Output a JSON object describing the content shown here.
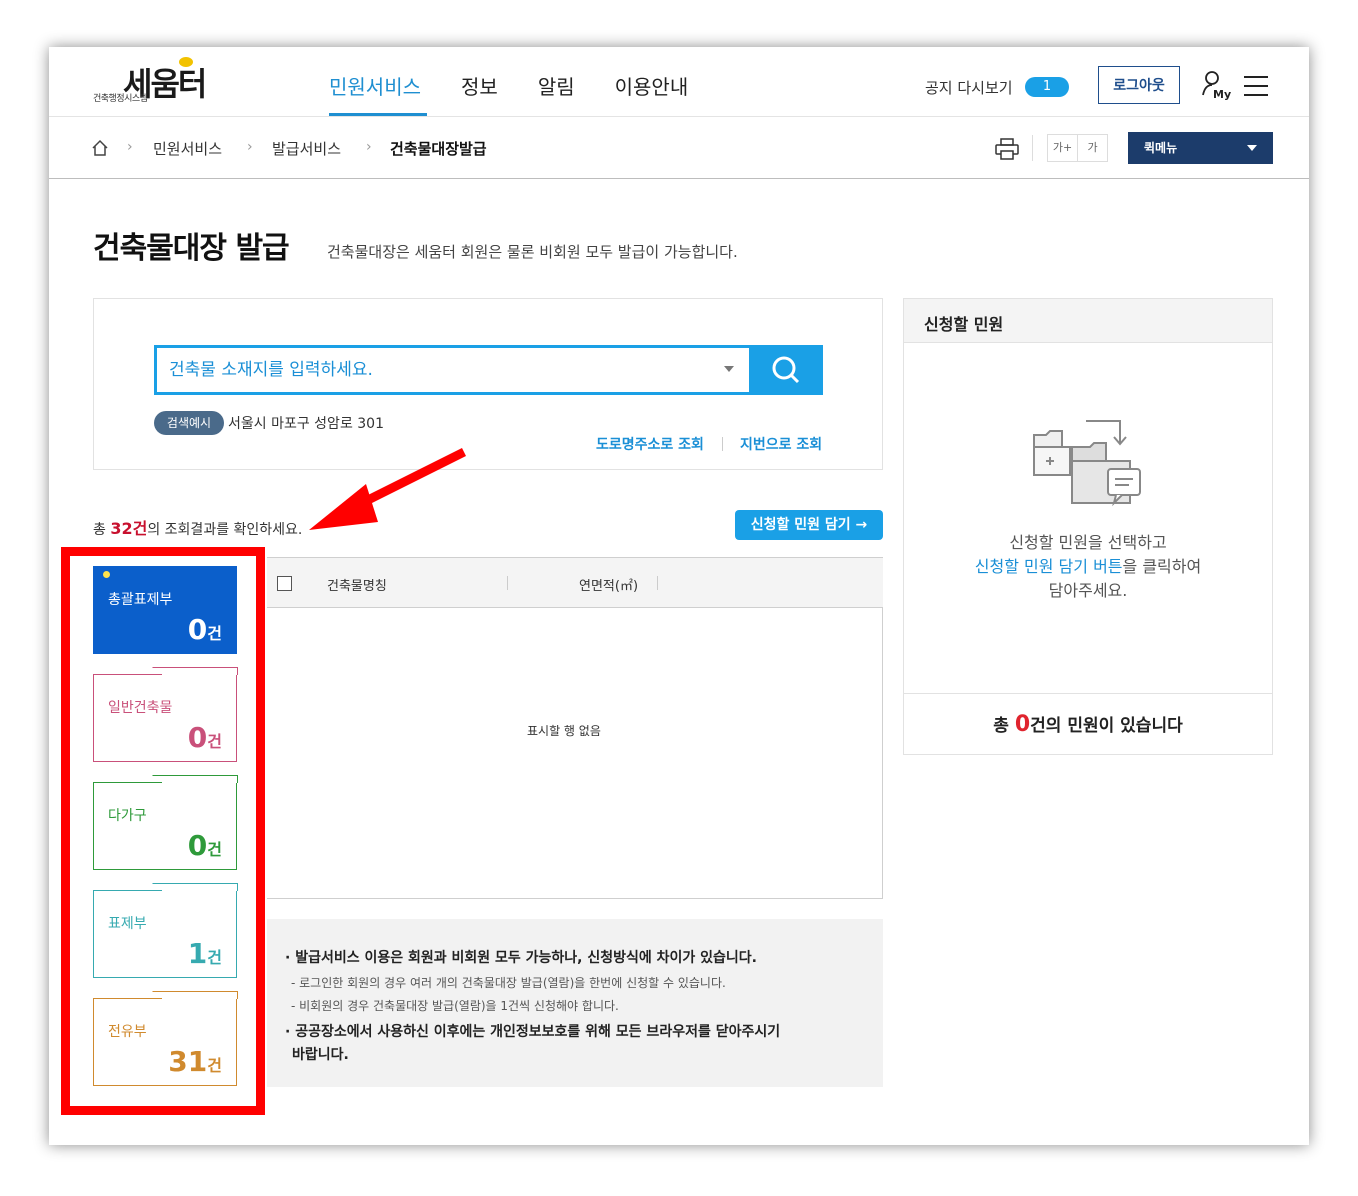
{
  "header": {
    "logo_sub": "건축행정시스템",
    "logo_main": "세움터",
    "nav": [
      "민원서비스",
      "정보",
      "알림",
      "이용안내"
    ],
    "notice_label": "공지 다시보기",
    "notice_count": "1",
    "logout_label": "로그아웃",
    "my_label": "My"
  },
  "breadcrumb": {
    "items": [
      "민원서비스",
      "발급서비스",
      "건축물대장발급"
    ],
    "font_larger": "가+",
    "font_smaller": "가",
    "quickmenu": "퀵메뉴"
  },
  "page": {
    "title": "건축물대장 발급",
    "desc": "건축물대장은 세움터 회원은 물론 비회원 모두 발급이 가능합니다."
  },
  "search": {
    "placeholder": "건축물 소재지를 입력하세요.",
    "example_badge": "검색예시",
    "example_text": "서울시 마포구 성암로 301",
    "link_road": "도로명주소로 조회",
    "link_jibun": "지번으로 조회"
  },
  "results": {
    "prefix": "총 ",
    "count": "32건",
    "suffix": "의 조회결과를 확인하세요.",
    "cart_button": "신청할 민원 담기 →"
  },
  "categories": [
    {
      "label": "총괄표제부",
      "count": "0",
      "unit": "건"
    },
    {
      "label": "일반건축물",
      "count": "0",
      "unit": "건"
    },
    {
      "label": "다가구",
      "count": "0",
      "unit": "건"
    },
    {
      "label": "표제부",
      "count": "1",
      "unit": "건"
    },
    {
      "label": "전유부",
      "count": "31",
      "unit": "건"
    }
  ],
  "table": {
    "col_name": "건축물명칭",
    "col_area": "연면적(㎡)",
    "empty": "표시할 행 없음"
  },
  "info": {
    "line1": "· 발급서비스 이용은 회원과 비회원 모두 가능하나, 신청방식에 차이가 있습니다.",
    "line2": "- 로그인한 회원의 경우 여러 개의 건축물대장 발급(열람)을 한번에 신청할 수 있습니다.",
    "line3": "- 비회원의 경우 건축물대장 발급(열람)을 1건씩 신청해야 합니다.",
    "line4": "· 공공장소에서 사용하신 이후에는 개인정보보호를 위해 모든 브라우저를 닫아주시기",
    "line5": "바랍니다."
  },
  "panel": {
    "title": "신청할 민원",
    "msg1": "신청할 민원을 선택하고",
    "msg2_hl": "신청할 민원 담기 버튼",
    "msg2_rest": "을 클릭하여",
    "msg3": "담아주세요.",
    "foot_prefix": "총 ",
    "foot_count": "0",
    "foot_suffix": "건의 민원이 있습니다"
  },
  "colors": {
    "accent": "#1aa0e6",
    "nav_active": "#1f8fd1",
    "quickmenu": "#1c3c6b",
    "cat_active": "#0b5fcb",
    "cat_general": "#c9507a",
    "cat_multi": "#2e9a3a",
    "cat_title": "#36aab0",
    "cat_unit": "#d08a2e",
    "annotation": "#ff0000"
  }
}
